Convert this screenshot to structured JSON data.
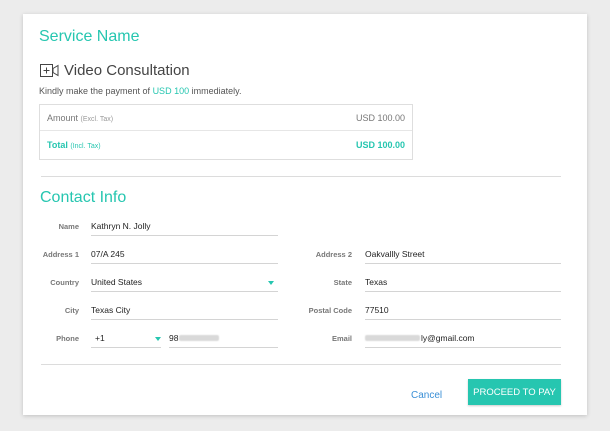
{
  "header": {
    "title": "Service Name"
  },
  "service": {
    "icon": "video-camera-icon",
    "name": "Video Consultation",
    "payment_prefix": "Kindly make the payment of ",
    "payment_amount": "USD 100",
    "payment_suffix": " immediately."
  },
  "summary": {
    "amount_label": "Amount",
    "amount_note": "(Excl. Tax)",
    "amount_value": "USD 100.00",
    "total_label": "Total",
    "total_note": "(Incl. Tax)",
    "total_value": "USD 100.00"
  },
  "contact": {
    "title": "Contact Info",
    "name_label": "Name",
    "name_value": "Kathryn N. Jolly",
    "address1_label": "Address 1",
    "address1_value": "07/A 245",
    "address2_label": "Address 2",
    "address2_value": "Oakvallly Street",
    "country_label": "Country",
    "country_value": "United States",
    "state_label": "State",
    "state_value": "Texas",
    "city_label": "City",
    "city_value": "Texas City",
    "postal_label": "Postal Code",
    "postal_value": "77510",
    "phone_label": "Phone",
    "phone_code": "+1",
    "phone_value_visible": "98",
    "email_label": "Email",
    "email_value_visible": "ly@gmail.com"
  },
  "actions": {
    "cancel_label": "Cancel",
    "pay_label": "PROCEED TO PAY"
  },
  "colors": {
    "accent": "#26c6b0",
    "link": "#3a8fd6"
  }
}
